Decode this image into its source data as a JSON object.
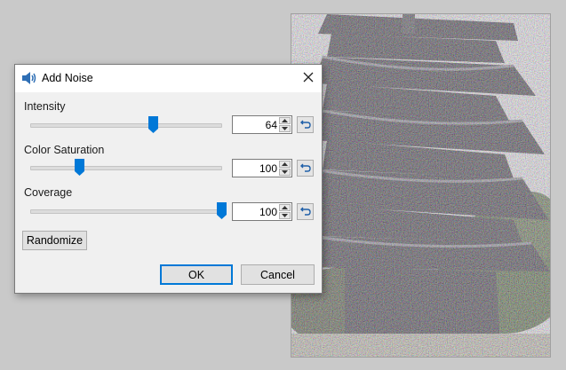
{
  "dialog": {
    "title": "Add Noise",
    "title_icon": "speaker-icon",
    "close_icon": "close-icon"
  },
  "controls": [
    {
      "label": "Intensity",
      "value": "64",
      "level": 0.64
    },
    {
      "label": "Color Saturation",
      "value": "100",
      "level": 0.25
    },
    {
      "label": "Coverage",
      "value": "100",
      "level": 1.0
    }
  ],
  "buttons": {
    "randomize": "Randomize",
    "ok": "OK",
    "cancel": "Cancel"
  },
  "colors": {
    "accent": "#0078d7"
  }
}
